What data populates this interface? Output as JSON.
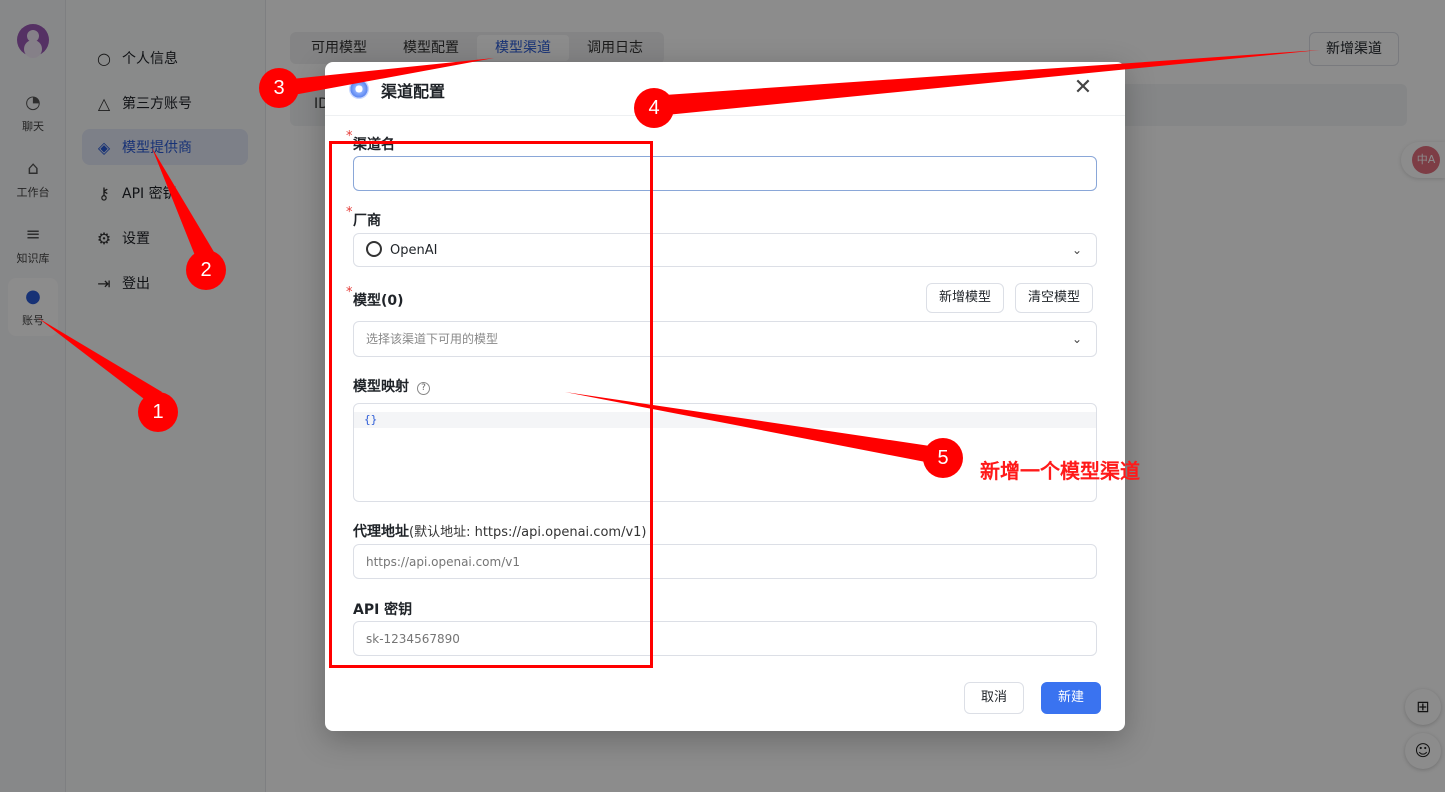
{
  "rail": {
    "items": [
      {
        "label": "聊天",
        "icon": "chat-icon"
      },
      {
        "label": "工作台",
        "icon": "robot-icon"
      },
      {
        "label": "知识库",
        "icon": "database-icon"
      },
      {
        "label": "账号",
        "icon": "user-icon"
      }
    ]
  },
  "sidebar": {
    "items": [
      {
        "label": "个人信息",
        "icon": "user-icon"
      },
      {
        "label": "第三方账号",
        "icon": "connections-icon"
      },
      {
        "label": "模型提供商",
        "icon": "model-provider-icon"
      },
      {
        "label": "API 密钥",
        "icon": "key-icon"
      },
      {
        "label": "设置",
        "icon": "gear-icon"
      },
      {
        "label": "登出",
        "icon": "logout-icon"
      }
    ]
  },
  "main": {
    "tabs": [
      {
        "label": "可用模型"
      },
      {
        "label": "模型配置"
      },
      {
        "label": "模型渠道"
      },
      {
        "label": "调用日志"
      }
    ],
    "add_channel_label": "新增渠道",
    "table_id_header": "ID"
  },
  "floating": {
    "lang_label": "中A",
    "apps_icon": "grid-icon",
    "assistant_icon": "bot-face-icon"
  },
  "modal": {
    "title": "渠道配置",
    "close_glyph": "✕",
    "channel_name": {
      "label": "渠道名",
      "value": ""
    },
    "vendor": {
      "label": "厂商",
      "value": "OpenAI"
    },
    "models": {
      "label": "模型(0)",
      "placeholder": "选择该渠道下可用的模型",
      "add_label": "新增模型",
      "clear_label": "清空模型"
    },
    "mapping": {
      "label": "模型映射",
      "help": "?",
      "code": "{}"
    },
    "proxy": {
      "label": "代理地址",
      "sub": "(默认地址: https://api.openai.com/v1)",
      "placeholder": "https://api.openai.com/v1"
    },
    "api_key": {
      "label": "API 密钥",
      "placeholder": "sk-1234567890"
    },
    "cancel_label": "取消",
    "create_label": "新建",
    "required_mark": "*"
  },
  "annotations": {
    "badges": [
      "1",
      "2",
      "3",
      "4",
      "5"
    ],
    "note": "新增一个模型渠道"
  },
  "colors": {
    "accent": "#2b5bd7",
    "primary_button": "#3a73f0",
    "annotation_red": "#ff0000"
  }
}
